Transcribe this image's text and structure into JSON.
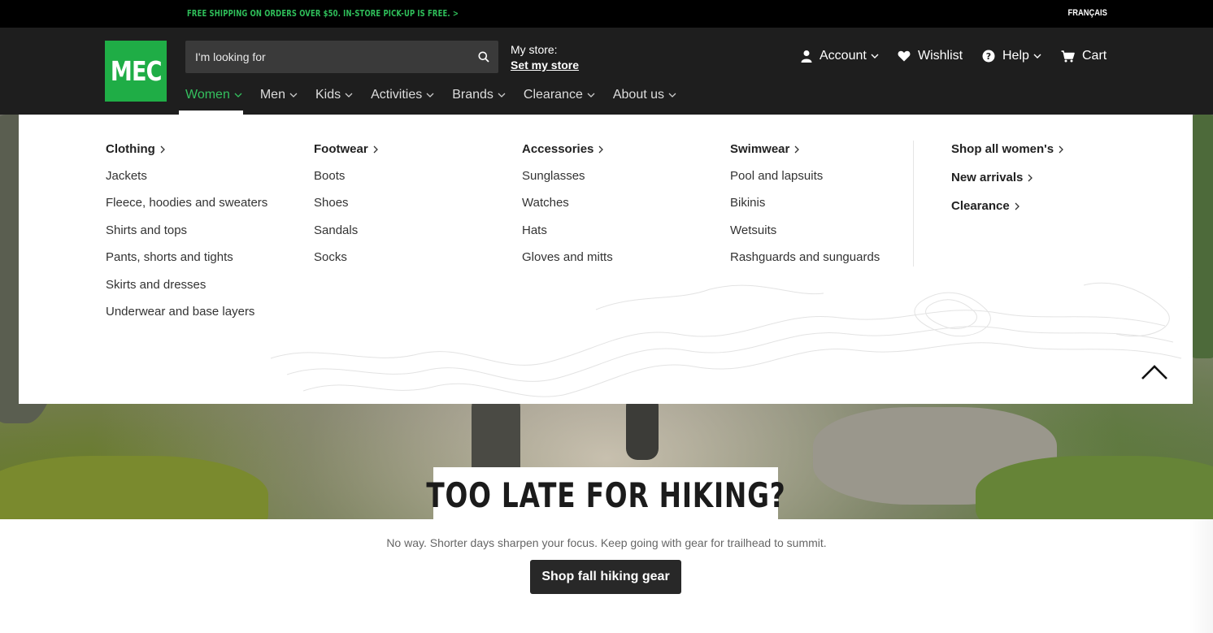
{
  "promo_bar": {
    "message": "FREE SHIPPING ON ORDERS OVER $50. IN-STORE PICK-UP IS FREE. >",
    "language_link": "FRANÇAIS"
  },
  "header": {
    "logo_text": "MEC",
    "search_placeholder": "I'm looking for",
    "store_label": "My store:",
    "store_link": "Set my store",
    "utility": {
      "account": "Account",
      "wishlist": "Wishlist",
      "help": "Help",
      "cart": "Cart"
    },
    "nav": [
      "Women",
      "Men",
      "Kids",
      "Activities",
      "Brands",
      "Clearance",
      "About us"
    ]
  },
  "mega_menu": {
    "columns": [
      {
        "heading": "Clothing",
        "items": [
          "Jackets",
          "Fleece, hoodies and sweaters",
          "Shirts and tops",
          "Pants, shorts and tights",
          "Skirts and dresses",
          "Underwear and base layers"
        ]
      },
      {
        "heading": "Footwear",
        "items": [
          "Boots",
          "Shoes",
          "Sandals",
          "Socks"
        ]
      },
      {
        "heading": "Accessories",
        "items": [
          "Sunglasses",
          "Watches",
          "Hats",
          "Gloves and mitts"
        ]
      },
      {
        "heading": "Swimwear",
        "items": [
          "Pool and lapsuits",
          "Bikinis",
          "Wetsuits",
          "Rashguards and sunguards"
        ]
      }
    ],
    "side_links": [
      "Shop all women's",
      "New arrivals",
      "Clearance"
    ]
  },
  "hero": {
    "headline": "TOO LATE FOR HIKING?",
    "subtext": "No way. Shorter days sharpen your focus. Keep going with gear for trailhead to summit.",
    "cta": "Shop fall hiking gear"
  },
  "colors": {
    "brand_green": "#1fad46",
    "active_nav": "#34c05e",
    "header_bg": "#1e1e1e"
  }
}
